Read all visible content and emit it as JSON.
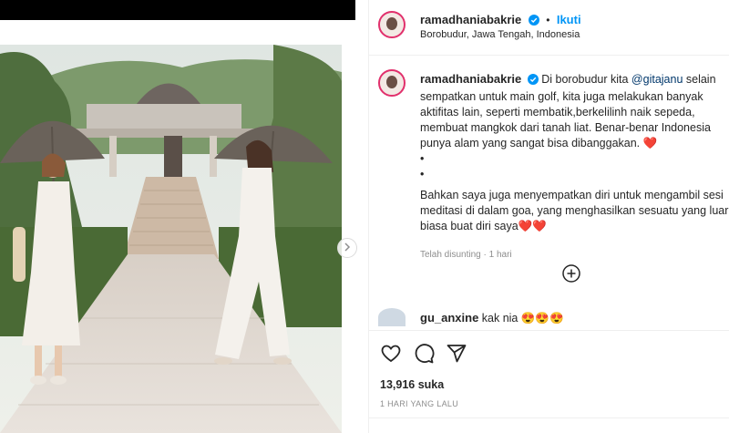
{
  "post": {
    "image_alt": "Two women holding parasols in front of a temple",
    "username": "ramadhaniabakrie",
    "follow_label": "Ikuti",
    "separator": "•",
    "location": "Borobudur, Jawa Tengah, Indonesia",
    "caption": {
      "username": "ramadhaniabakrie",
      "text_before_mention": "Di borobudur kita ",
      "mention": "@gitajanu",
      "text_after_mention": " selain sempatkan untuk main golf, kita juga melakukan banyak aktifitas lain, seperti membatik,berkelilinh naik sepeda, membuat mangkok dari tanah liat. Benar-benar Indonesia punya alam yang sangat bisa dibanggakan. ❤️",
      "dot1": "•",
      "dot2": "•",
      "paragraph2": "Bahkan saya juga menyempatkan diri untuk mengambil sesi meditasi di dalam goa, yang menghasilkan sesuatu yang luar biasa buat diri saya❤️❤️",
      "edited": "Telah disunting · 1 hari"
    },
    "comment": {
      "username": "gu_anxine",
      "text": "kak nia 😍😍😍"
    },
    "likes": "13,916 suka",
    "time_ago": "1 HARI YANG LALU"
  },
  "colors": {
    "accent": "#0095f6",
    "mention": "#00376b",
    "heart": "#ed4956"
  },
  "icons": [
    "verified-icon",
    "heart-icon",
    "comment-icon",
    "share-icon",
    "add-comment-icon",
    "chevron-right-icon"
  ]
}
